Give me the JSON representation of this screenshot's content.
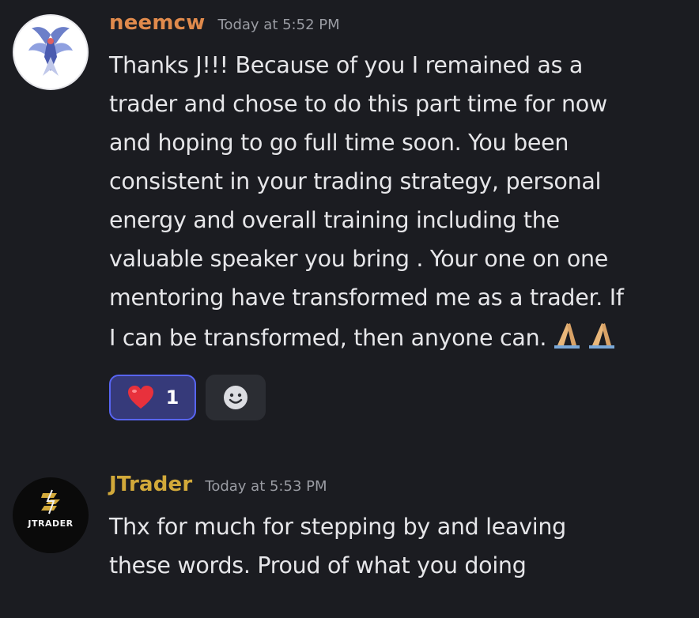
{
  "messages": [
    {
      "username": "neemcw",
      "timestamp": "Today at 5:52 PM",
      "avatar_icon": "winged-emblem-icon",
      "lines": [
        "Thanks J!!! Because of you I remained as a",
        "trader and chose to do this part time for now",
        "and hoping to go full time soon. You been",
        "consistent in your trading strategy, personal",
        "energy and overall training including the",
        "valuable speaker you bring . Your one on one",
        "mentoring have transformed me as a trader. If",
        "I can be transformed, then anyone can."
      ],
      "trailing_emoji": "praying-hands-icon",
      "reactions": [
        {
          "icon": "heart-icon",
          "count": "1",
          "active": true
        }
      ],
      "add_reaction_icon": "smiley-icon"
    },
    {
      "username": "JTrader",
      "timestamp": "Today at 5:53 PM",
      "avatar_text": "JTRADER",
      "lines": [
        "Thx for much for stepping by and leaving",
        "these words. Proud of what you doing"
      ]
    }
  ],
  "colors": {
    "background": "#1b1c21",
    "username_1": "#e08a4c",
    "username_2": "#d2a93a",
    "timestamp": "#9a9ca3",
    "text": "#e6e6e9",
    "reaction_active_bg": "#363a7a",
    "reaction_active_border": "#5865f2"
  }
}
